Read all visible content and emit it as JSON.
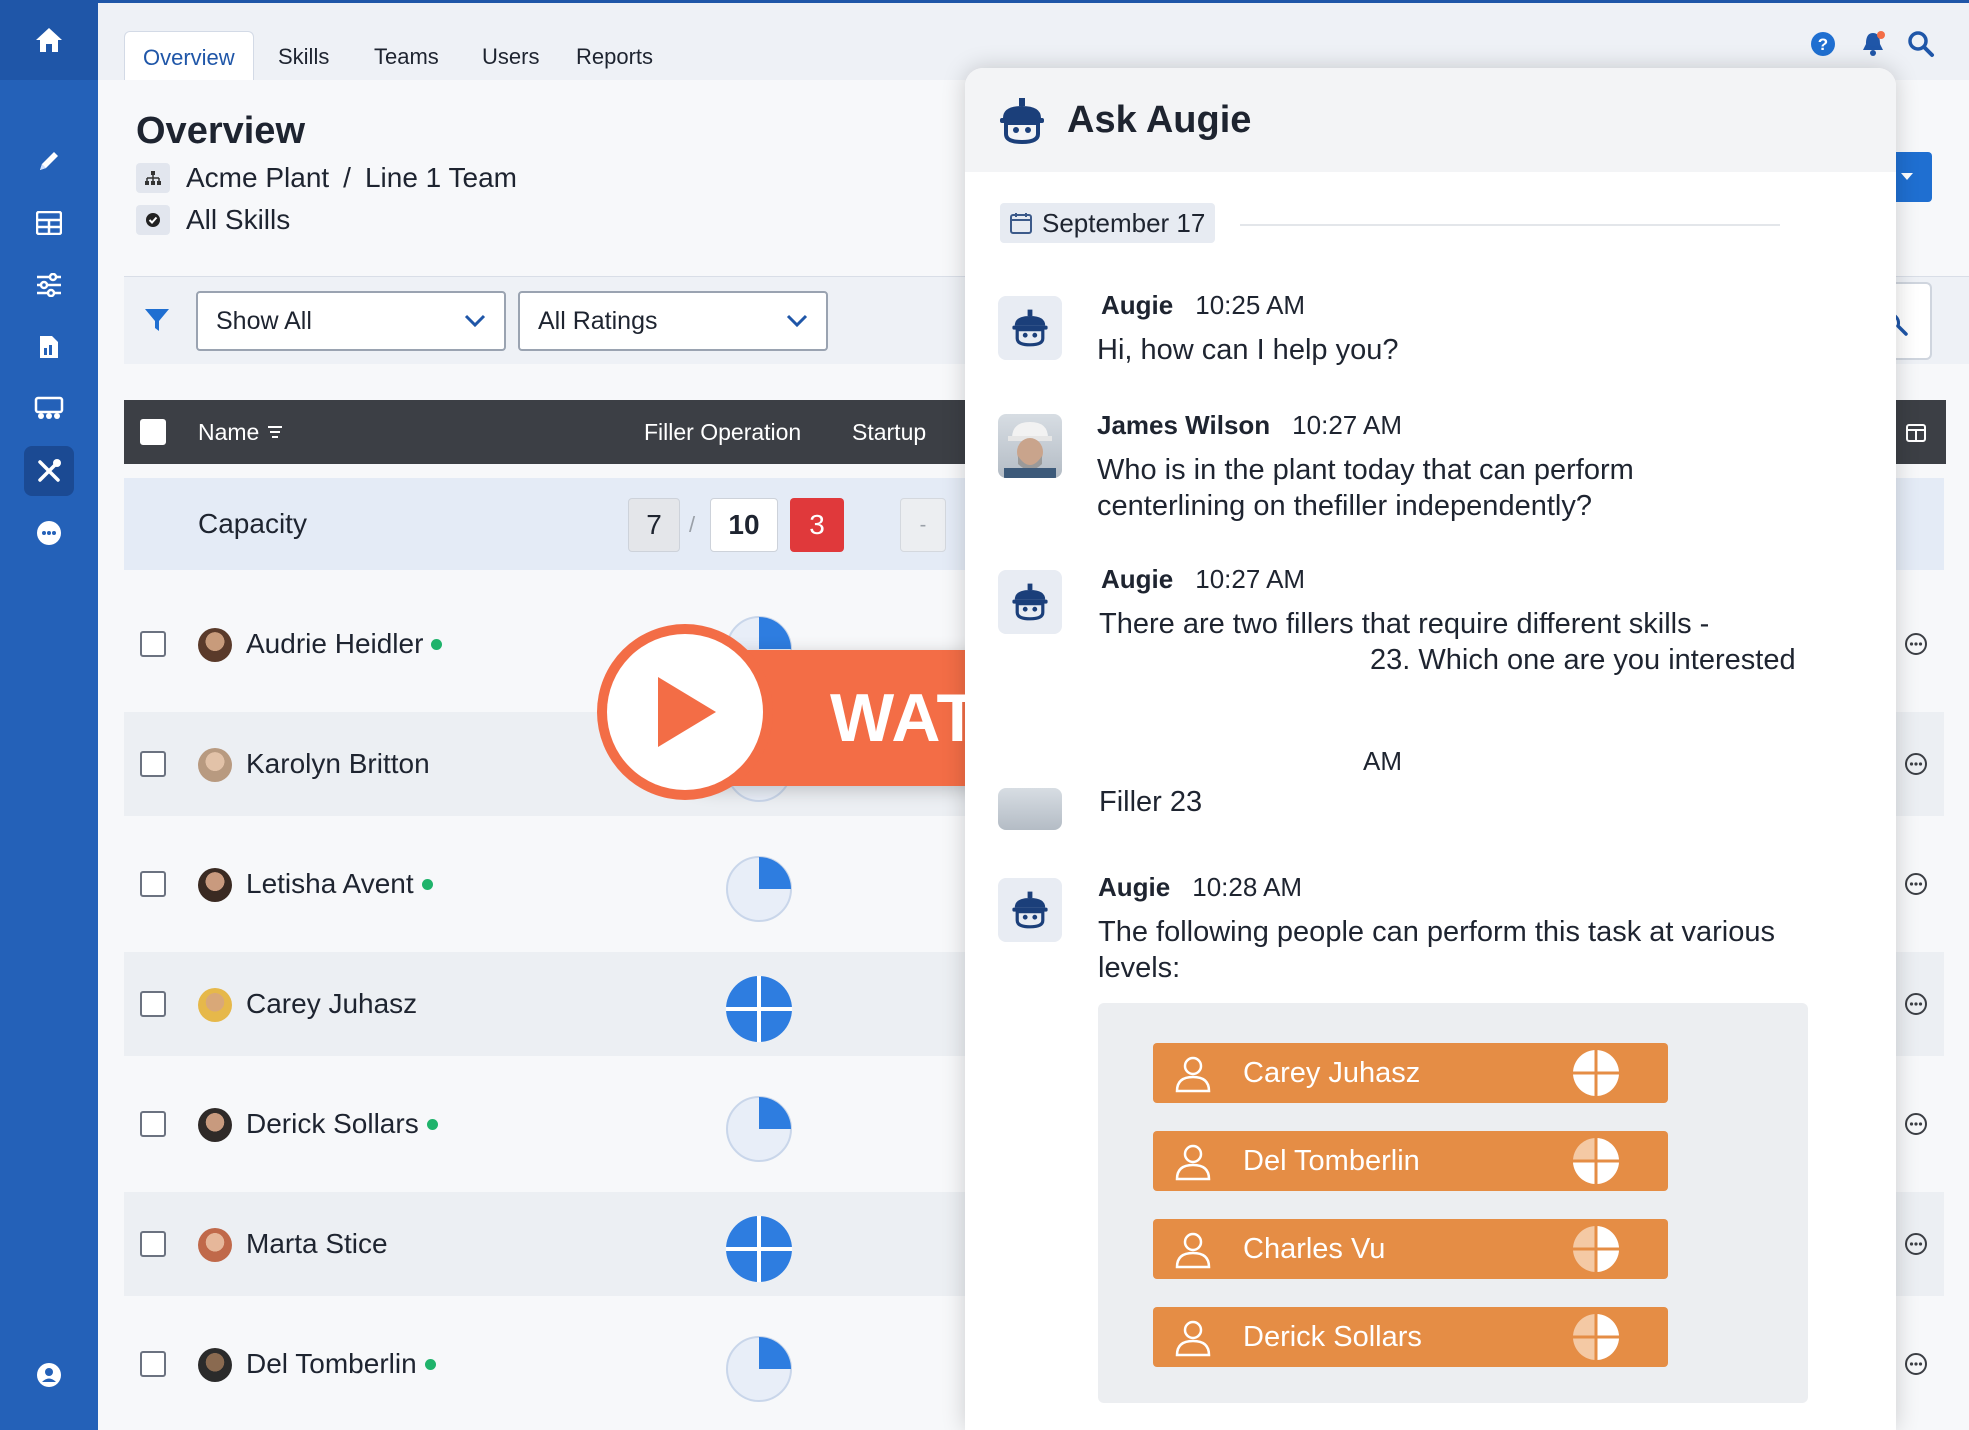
{
  "nav": {
    "tabs": [
      {
        "label": "Overview",
        "active": true
      },
      {
        "label": "Skills"
      },
      {
        "label": "Teams"
      },
      {
        "label": "Users"
      },
      {
        "label": "Reports"
      }
    ],
    "icons": [
      "help-icon",
      "bell-icon",
      "search-icon"
    ]
  },
  "sidebar": {
    "icons": [
      "home-icon",
      "pencil-icon",
      "grid-icon",
      "sliders-icon",
      "report-icon",
      "team-icon",
      "tools-icon",
      "more-icon",
      "user-icon"
    ]
  },
  "page": {
    "title": "Overview",
    "breadcrumb": [
      "Acme Plant",
      "/",
      "Line 1 Team"
    ],
    "skill_scope": "All Skills"
  },
  "filters": {
    "show": "Show All",
    "ratings": "All Ratings"
  },
  "table": {
    "columns": [
      "Name",
      "Filler Operation",
      "Startup"
    ],
    "capacity": {
      "label": "Capacity",
      "current": "7",
      "slash": "/",
      "target": "10",
      "gap": "3",
      "next_current": "-"
    },
    "rows": [
      {
        "name": "Audrie Heidler",
        "online": true,
        "level": 0.25
      },
      {
        "name": "Karolyn Britton",
        "online": false,
        "level": 0.25
      },
      {
        "name": "Letisha Avent",
        "online": true,
        "level": 0.25
      },
      {
        "name": "Carey Juhasz",
        "online": false,
        "level": 1.0
      },
      {
        "name": "Derick Sollars",
        "online": true,
        "level": 0.25
      },
      {
        "name": "Marta Stice",
        "online": false,
        "level": 1.0
      },
      {
        "name": "Del Tomberlin",
        "online": true,
        "level": 0.25
      }
    ]
  },
  "chat": {
    "title": "Ask Augie",
    "date": "September 17",
    "messages": [
      {
        "sender": "Augie",
        "time": "10:25 AM",
        "text": "Hi, how can I help you?"
      },
      {
        "sender": "James Wilson",
        "time": "10:27 AM",
        "text": "Who is in the plant today that can perform centerlining on thefiller independently?"
      },
      {
        "sender": "Augie",
        "time": "10:27 AM",
        "text": "There are two fillers that require different skills -",
        "text2": "23. Which one are you interested"
      },
      {
        "sender": "",
        "time": "AM",
        "text": "Filler 23"
      },
      {
        "sender": "Augie",
        "time": "10:28 AM",
        "text": "The following people can perform this task at various levels:"
      }
    ],
    "people": [
      {
        "name": "Carey Juhasz",
        "level": 1.0
      },
      {
        "name": "Del Tomberlin",
        "level": 0.75
      },
      {
        "name": "Charles Vu",
        "level": 0.5
      },
      {
        "name": "Derick Sollars",
        "level": 0.5
      }
    ]
  },
  "overlay": {
    "label": "WATCH VIDEO"
  },
  "colors": {
    "brand": "#2461b8",
    "accent_orange": "#f36d46",
    "person_bar": "#e58d45",
    "gap_red": "#e0393b",
    "online": "#1fb36b",
    "pie_blue": "#2e7de0"
  }
}
